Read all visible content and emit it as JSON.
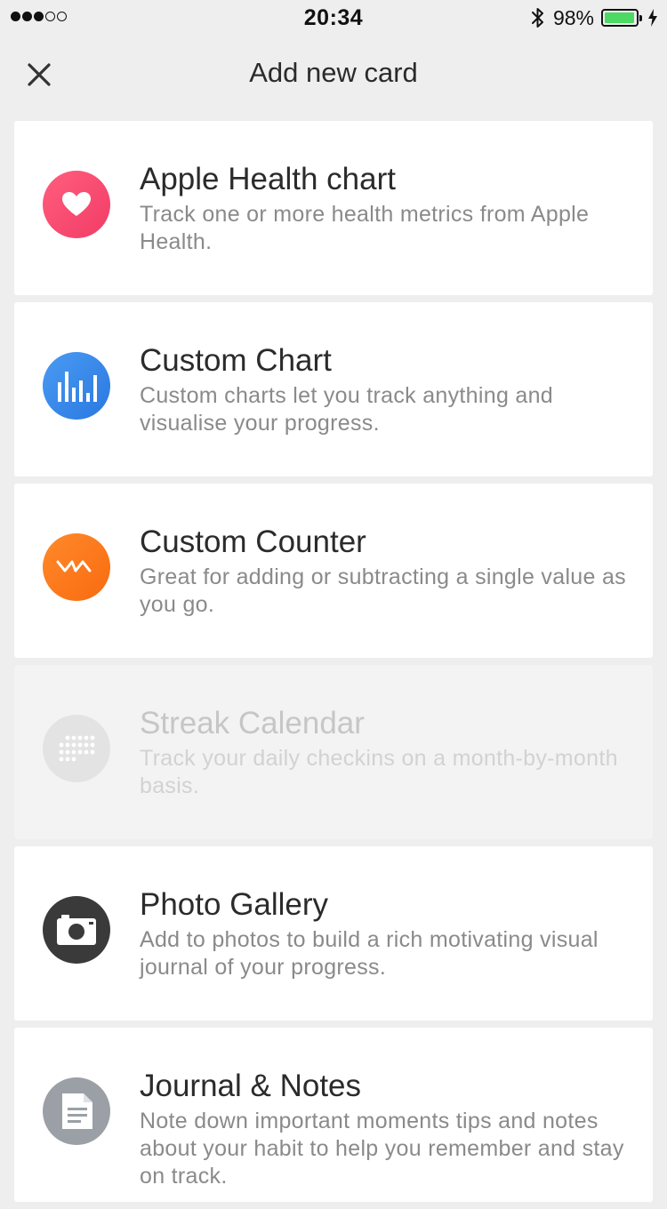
{
  "status_bar": {
    "time": "20:34",
    "battery_percent": "98%",
    "battery_level": 0.98,
    "signal_bars_filled": 3,
    "signal_bars_total": 5
  },
  "nav": {
    "title": "Add new card"
  },
  "cards": [
    {
      "title": "Apple Health chart",
      "description": "Track one or more health metrics from Apple Health.",
      "icon": "heart-icon",
      "color": "#f5486e",
      "enabled": true
    },
    {
      "title": "Custom Chart",
      "description": "Custom charts let you track anything and visualise your progress.",
      "icon": "bar-chart-icon",
      "color": "#3486e8",
      "enabled": true
    },
    {
      "title": "Custom Counter",
      "description": "Great for adding or subtracting a single value as you go.",
      "icon": "counter-icon",
      "color": "#fb7419",
      "enabled": true
    },
    {
      "title": "Streak Calendar",
      "description": "Track your daily checkins on a month-by-month basis.",
      "icon": "calendar-dots-icon",
      "color": "#e3e3e3",
      "enabled": false
    },
    {
      "title": "Photo Gallery",
      "description": "Add to photos to build a rich motivating visual journal of  your progress.",
      "icon": "camera-icon",
      "color": "#3a3a3a",
      "enabled": true
    },
    {
      "title": "Journal & Notes",
      "description": "Note down important moments tips and notes about your habit to help you remember and stay on track.",
      "icon": "document-icon",
      "color": "#9aa0a6",
      "enabled": true
    }
  ]
}
